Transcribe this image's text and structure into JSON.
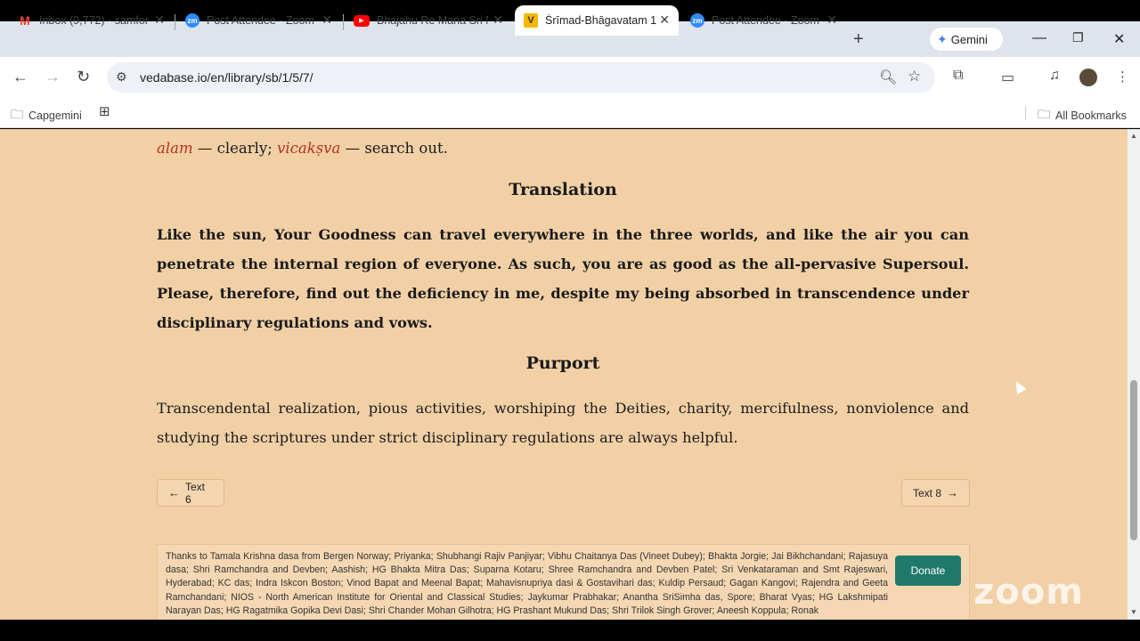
{
  "browser": {
    "tabs": [
      {
        "title": "Inbox (9,772) - samfor",
        "icon": "gmail-icon",
        "icon_color": "#ea4335",
        "active": false
      },
      {
        "title": "Post Attendee - Zoom",
        "icon": "zoom-icon",
        "icon_color": "#2d8cff",
        "active": false
      },
      {
        "title": "Bhajahu Re Mana Sri N",
        "icon": "youtube-icon",
        "icon_color": "#ff0000",
        "active": false
      },
      {
        "title": "Śrīmad-Bhāgavatam 1",
        "icon": "vedabase-icon",
        "icon_color": "#f2b900",
        "active": true
      },
      {
        "title": "Post Attendee - Zoom",
        "icon": "zoom-icon",
        "icon_color": "#2d8cff",
        "active": false
      }
    ],
    "gemini_label": "Gemini",
    "url": "vedabase.io/en/library/sb/1/5/7/",
    "bookmarks": [
      {
        "label": "Capgemini",
        "icon": "folder-settings-icon"
      }
    ],
    "all_bookmarks_label": "All Bookmarks"
  },
  "page": {
    "synonyms": {
      "w1": "alam",
      "d1": " — clearly; ",
      "w2": "vicakṣva",
      "d2": " — search out."
    },
    "translation_heading": "Translation",
    "translation_text": "Like the sun, Your Goodness can travel everywhere in the three worlds, and like the air you can penetrate the internal region of everyone. As such, you are as good as the all-pervasive Supersoul. Please, therefore, find out the deficiency in me, despite my being absorbed in transcendence under disciplinary regulations and vows.",
    "purport_heading": "Purport",
    "purport_text": "Transcendental realization, pious activities, worshiping the Deities, charity, mercifulness, nonviolence and studying the scriptures under strict disciplinary regulations are always helpful.",
    "prev_label": "Text 6",
    "next_label": "Text 8",
    "thanks_text": "Thanks to Tamala Krishna dasa from Bergen Norway; Priyanka; Shubhangi Rajiv Panjiyar; Vibhu Chaitanya Das (Vineet Dubey); Bhakta Jorgie; Jai Bikhchandani; Rajasuya dasa; Shri Ramchandra and Devben; Aashish; HG Bhakta Mitra Das; Suparna Kotaru; Shree Ramchandra and Devben Patel; Sri Venkataraman and Smt Rajeswari, Hyderabad; KC das; Indra Iskcon Boston; Vinod Bapat and Meenal Bapat; Mahavisnupriya dasi & Gostavihari das; Kuldip Persaud; Gagan Kangovi; Rajendra and Geeta Ramchandani; NIOS - North American Institute for Oriental and Classical Studies; Jaykumar Prabhakar; Anantha SriSimha das, Spore; Bharat Vyas; HG Lakshmipati Narayan Das; HG Ragatmika Gopika Devi Dasi; Shri Chander Mohan Gilhotra; HG Prashant Mukund Das; Shri Trilok Singh Grover; Aneesh Koppula; Ronak",
    "donate_label": "Donate"
  },
  "overlay": {
    "watermark": "zoom"
  },
  "colors": {
    "page_bg": "#f2d0a6",
    "sanskrit_word": "#b5321c",
    "donate_bg": "#1f7a6c"
  }
}
